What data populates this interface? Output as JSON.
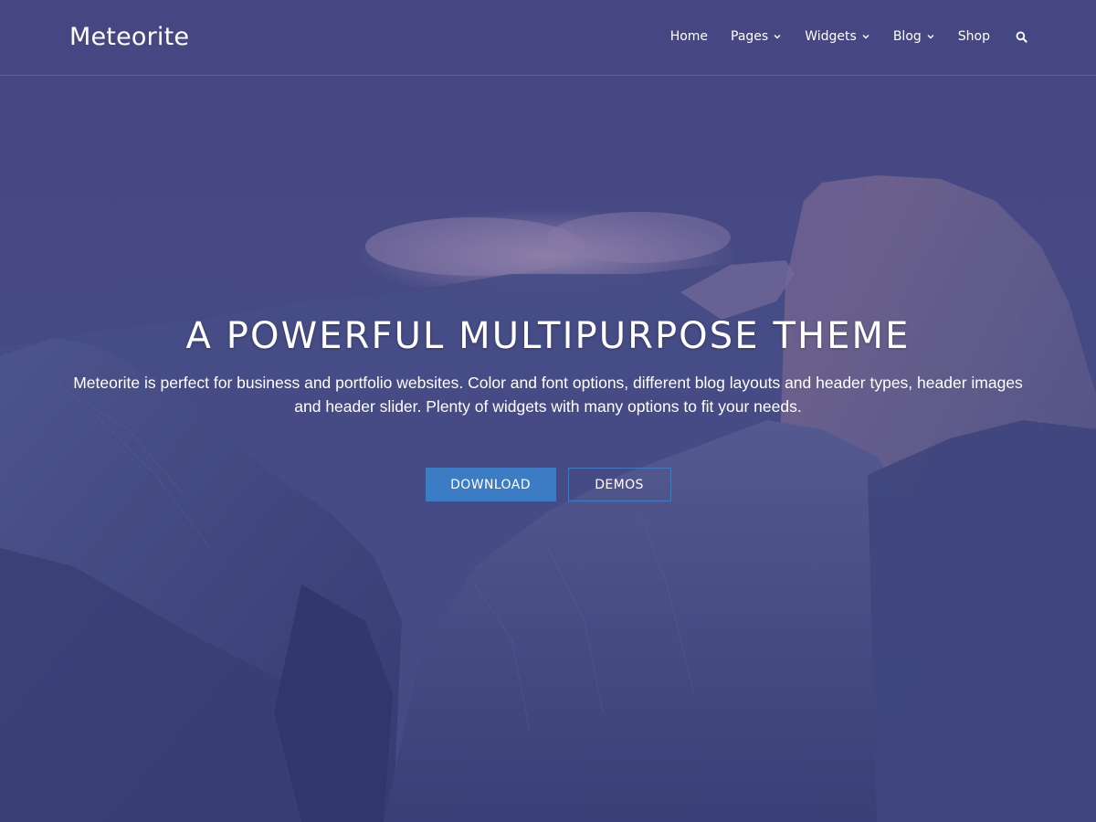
{
  "site": {
    "title": "Meteorite"
  },
  "nav": {
    "items": [
      {
        "label": "Home",
        "dropdown": false
      },
      {
        "label": "Pages",
        "dropdown": true
      },
      {
        "label": "Widgets",
        "dropdown": true
      },
      {
        "label": "Blog",
        "dropdown": true
      },
      {
        "label": "Shop",
        "dropdown": false
      }
    ],
    "search_icon": "search-icon",
    "dropdown_icon": "chevron-down-icon"
  },
  "hero": {
    "title": "A POWERFUL MULTIPURPOSE THEME",
    "text": "Meteorite is perfect for business and portfolio websites. Color and font options, different blog layouts and header types, header images and header slider. Plenty of widgets with many options to fit your needs.",
    "primary_button": "DOWNLOAD",
    "secondary_button": "DEMOS"
  },
  "colors": {
    "overlay": "#3d3f78",
    "accent": "#3b7cc4",
    "text": "#ffffff"
  }
}
